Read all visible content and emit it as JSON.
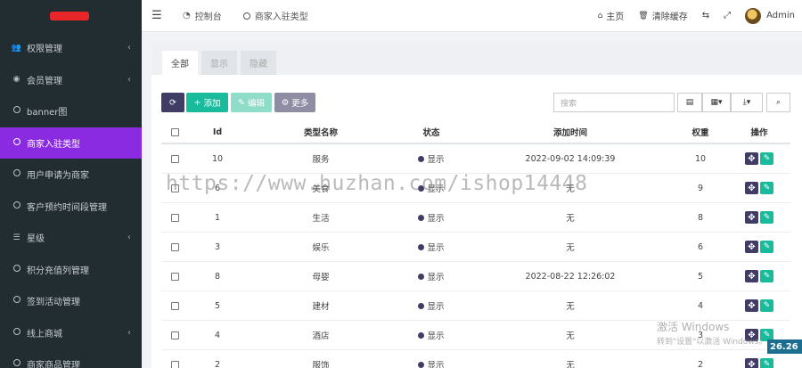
{
  "sidebar": {
    "items": [
      {
        "label": "权限管理",
        "icon": "users-icon",
        "caret": true,
        "active": false
      },
      {
        "label": "会员管理",
        "icon": "user-circle-icon",
        "caret": true,
        "active": false
      },
      {
        "label": "banner图",
        "icon": "circle-icon",
        "caret": false,
        "active": false
      },
      {
        "label": "商家入驻类型",
        "icon": "circle-icon",
        "caret": false,
        "active": true
      },
      {
        "label": "用户申请为商家",
        "icon": "circle-icon",
        "caret": false,
        "active": false
      },
      {
        "label": "客户预约时间段管理",
        "icon": "circle-icon",
        "caret": false,
        "active": false
      },
      {
        "label": "星级",
        "icon": "list-icon",
        "caret": true,
        "active": false
      },
      {
        "label": "积分充值列管理",
        "icon": "circle-icon",
        "caret": false,
        "active": false
      },
      {
        "label": "签到活动管理",
        "icon": "circle-icon",
        "caret": false,
        "active": false
      },
      {
        "label": "线上商城",
        "icon": "circle-icon",
        "caret": true,
        "active": false
      },
      {
        "label": "商家商品管理",
        "icon": "circle-icon",
        "caret": false,
        "active": false
      }
    ]
  },
  "topbar": {
    "tabs": [
      {
        "label": "控制台",
        "icon": "dashboard-icon"
      },
      {
        "label": "商家入驻类型",
        "icon": "circle-icon"
      }
    ],
    "home": "主页",
    "clear_cache": "清除缓存",
    "user": "Admin"
  },
  "subtabs": [
    "全部",
    "显示",
    "隐藏"
  ],
  "toolbar": {
    "add": "添加",
    "edit": "编辑",
    "more": "更多",
    "search_placeholder": "搜索"
  },
  "table": {
    "columns": [
      "Id",
      "类型名称",
      "状态",
      "添加时间",
      "权重",
      "操作"
    ],
    "rows": [
      {
        "id": "10",
        "name": "服务",
        "status": "显示",
        "time": "2022-09-02 14:09:39",
        "weight": "10"
      },
      {
        "id": "6",
        "name": "美食",
        "status": "显示",
        "time": "无",
        "weight": "9"
      },
      {
        "id": "1",
        "name": "生活",
        "status": "显示",
        "time": "无",
        "weight": "8"
      },
      {
        "id": "3",
        "name": "娱乐",
        "status": "显示",
        "time": "无",
        "weight": "6"
      },
      {
        "id": "8",
        "name": "母婴",
        "status": "显示",
        "time": "2022-08-22 12:26:02",
        "weight": "5"
      },
      {
        "id": "5",
        "name": "建材",
        "status": "显示",
        "time": "无",
        "weight": "4"
      },
      {
        "id": "4",
        "name": "酒店",
        "status": "显示",
        "time": "无",
        "weight": "3"
      },
      {
        "id": "2",
        "name": "服饰",
        "status": "显示",
        "time": "无",
        "weight": "2"
      }
    ]
  },
  "overlay": {
    "watermark": "https://www.huzhan.com/ishop14448",
    "activate_title": "激活 Windows",
    "activate_sub": "转到\"设置\"以激活 Windows。",
    "clock": "26.26"
  },
  "colors": {
    "sidebar_bg": "#222d32",
    "active": "#8a2be2",
    "primary": "#3f3d66",
    "success": "#18bc9c"
  }
}
